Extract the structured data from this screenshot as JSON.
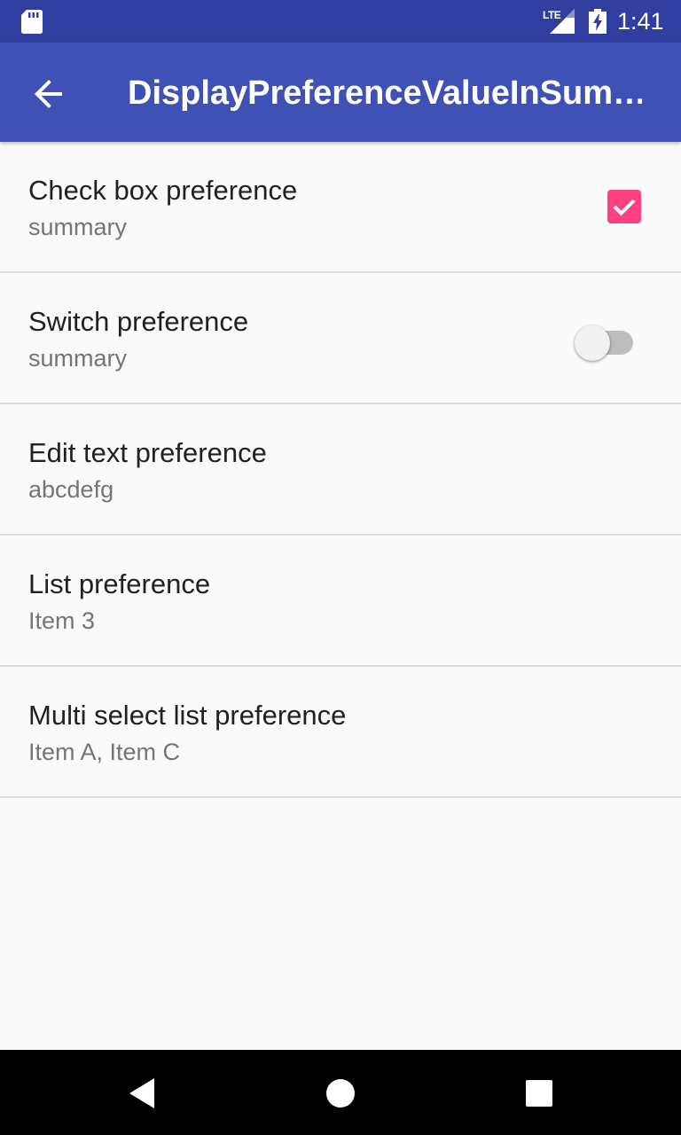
{
  "status_bar": {
    "time": "1:41",
    "network": "LTE",
    "icons": [
      "sd-card-icon",
      "signal-icon",
      "battery-charging-icon"
    ]
  },
  "app_bar": {
    "title": "DisplayPreferenceValueInSum…",
    "back_icon": "arrow-back-icon"
  },
  "preferences": [
    {
      "title": "Check box preference",
      "summary": "summary",
      "widget": "checkbox",
      "checked": true
    },
    {
      "title": "Switch preference",
      "summary": "summary",
      "widget": "switch",
      "checked": false
    },
    {
      "title": "Edit text preference",
      "summary": "abcdefg"
    },
    {
      "title": "List preference",
      "summary": "Item 3"
    },
    {
      "title": "Multi select list preference",
      "summary": "Item A, Item C"
    }
  ],
  "nav_bar": {
    "icons": [
      "back-triangle-icon",
      "home-circle-icon",
      "recents-square-icon"
    ]
  },
  "colors": {
    "status_bar": "#303f9f",
    "app_bar": "#3f51b5",
    "accent": "#ff4081",
    "background": "#fafafa"
  }
}
